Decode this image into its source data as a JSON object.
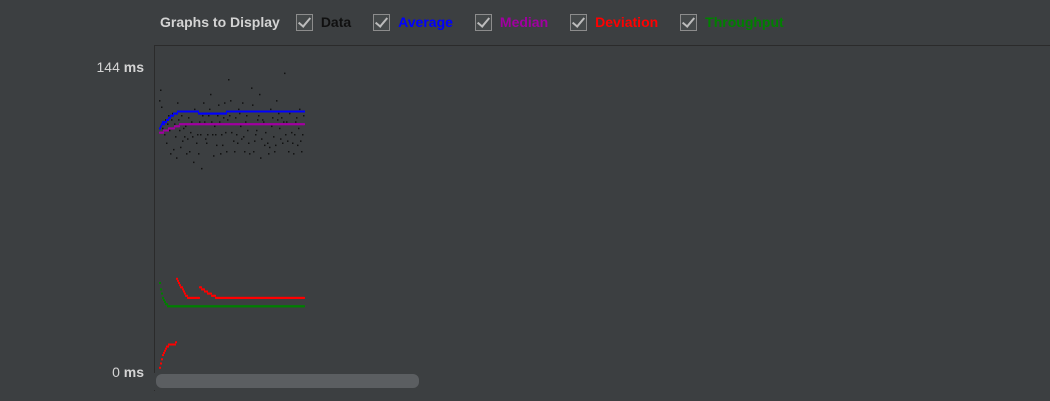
{
  "toolbar": {
    "title": "Graphs to Display",
    "options": [
      {
        "label": "Data",
        "color": "#101010",
        "checked": true
      },
      {
        "label": "Average",
        "color": "#0000ff",
        "checked": true
      },
      {
        "label": "Median",
        "color": "#a000a0",
        "checked": true
      },
      {
        "label": "Deviation",
        "color": "#ff0000",
        "checked": true
      },
      {
        "label": "Throughput",
        "color": "#008000",
        "checked": true
      }
    ]
  },
  "axis": {
    "top_value": "144",
    "bottom_value": "0",
    "unit": "ms"
  },
  "chart_data": {
    "type": "scatter",
    "ylim": [
      0,
      144
    ],
    "yunit": "ms",
    "n_samples": 145,
    "series": [
      {
        "name": "Data",
        "color": "#111111",
        "kind": "points",
        "values": [
          128,
          133,
          125,
          115,
          118,
          112,
          119,
          108,
          117,
          121,
          114,
          103,
          119,
          122,
          105,
          117,
          111,
          101,
          127,
          119,
          114,
          106,
          121,
          109,
          115,
          111,
          116,
          103,
          110,
          120,
          104,
          113,
          118,
          111,
          99,
          124,
          117,
          108,
          112,
          103,
          118,
          112,
          96,
          121,
          127,
          118,
          110,
          108,
          112,
          121,
          124,
          131,
          118,
          112,
          102,
          116,
          112,
          107,
          121,
          126,
          118,
          103,
          112,
          107,
          120,
          127,
          113,
          104,
          119,
          138,
          121,
          128,
          113,
          117,
          109,
          104,
          120,
          112,
          108,
          124,
          122,
          116,
          110,
          127,
          111,
          104,
          118,
          121,
          114,
          108,
          103,
          123,
          134,
          126,
          104,
          109,
          112,
          114,
          119,
          121,
          131,
          101,
          110,
          119,
          118,
          107,
          113,
          117,
          108,
          103,
          106,
          124,
          116,
          120,
          111,
          104,
          107,
          128,
          119,
          122,
          115,
          110,
          120,
          108,
          118,
          141,
          112,
          118,
          109,
          104,
          122,
          117,
          113,
          108,
          103,
          112,
          118,
          120,
          107,
          115,
          124,
          109,
          104,
          112,
          121
        ]
      },
      {
        "name": "Average",
        "color": "#0000ff",
        "kind": "points",
        "values": [
          115,
          116,
          117,
          118,
          117,
          118,
          118,
          119,
          119,
          120,
          120,
          121,
          121,
          121,
          122,
          122,
          122,
          122,
          123,
          123,
          123,
          123,
          123,
          123,
          123,
          123,
          123,
          123,
          123,
          123,
          123,
          123,
          123,
          123,
          123,
          123,
          123,
          123,
          123,
          122,
          122,
          122,
          122,
          122,
          122,
          122,
          122,
          122,
          122,
          122,
          122,
          122,
          122,
          122,
          122,
          122,
          122,
          122,
          122,
          122,
          122,
          122,
          122,
          122,
          122,
          122,
          122,
          123,
          123,
          123,
          123,
          123,
          123,
          123,
          123,
          123,
          123,
          123,
          123,
          123,
          123,
          123,
          123,
          123,
          123,
          123,
          123,
          123,
          123,
          123,
          123,
          123,
          123,
          123,
          123,
          123,
          123,
          123,
          123,
          123,
          123,
          123,
          123,
          123,
          123,
          123,
          123,
          123,
          123,
          123,
          123,
          123,
          123,
          123,
          123,
          123,
          123,
          123,
          123,
          123,
          123,
          123,
          123,
          123,
          123,
          123,
          123,
          123,
          123,
          123,
          123,
          123,
          123,
          123,
          123,
          123,
          123,
          123,
          123,
          123,
          123,
          123,
          123,
          123,
          123
        ]
      },
      {
        "name": "Median",
        "color": "#a000a0",
        "kind": "points",
        "values": [
          113,
          113,
          113,
          113,
          114,
          114,
          114,
          114,
          114,
          115,
          115,
          115,
          115,
          115,
          115,
          116,
          116,
          116,
          116,
          116,
          117,
          117,
          117,
          117,
          117,
          117,
          117,
          117,
          117,
          117,
          117,
          117,
          117,
          117,
          117,
          117,
          117,
          117,
          117,
          117,
          117,
          117,
          117,
          117,
          117,
          117,
          117,
          117,
          117,
          117,
          117,
          117,
          117,
          117,
          117,
          117,
          117,
          117,
          117,
          117,
          117,
          117,
          117,
          117,
          117,
          117,
          117,
          117,
          117,
          117,
          117,
          117,
          117,
          117,
          117,
          117,
          117,
          117,
          117,
          117,
          117,
          117,
          117,
          117,
          117,
          117,
          117,
          117,
          117,
          117,
          117,
          117,
          117,
          117,
          117,
          117,
          117,
          117,
          117,
          117,
          117,
          117,
          117,
          117,
          117,
          117,
          117,
          117,
          117,
          117,
          117,
          117,
          117,
          117,
          117,
          117,
          117,
          117,
          117,
          117,
          117,
          117,
          117,
          117,
          117,
          117,
          117,
          117,
          117,
          117,
          117,
          117,
          117,
          117,
          117,
          117,
          117,
          117,
          117,
          117,
          117,
          117,
          117,
          117,
          117
        ]
      },
      {
        "name": "Deviation",
        "color": "#ff0000",
        "kind": "points",
        "values": [
          2,
          4,
          6,
          8,
          9,
          10,
          11,
          12,
          12,
          13,
          13,
          13,
          13,
          13,
          13,
          13,
          14,
          44,
          43,
          42,
          41,
          40,
          40,
          39,
          38,
          37,
          36,
          36,
          35,
          35,
          35,
          35,
          35,
          35,
          35,
          35,
          35,
          35,
          35,
          35,
          40,
          40,
          39,
          39,
          39,
          38,
          38,
          38,
          37,
          37,
          37,
          37,
          36,
          36,
          36,
          36,
          35,
          35,
          35,
          35,
          35,
          35,
          35,
          35,
          35,
          35,
          35,
          35,
          35,
          35,
          35,
          35,
          35,
          35,
          35,
          35,
          35,
          35,
          35,
          35,
          35,
          35,
          35,
          35,
          35,
          35,
          35,
          35,
          35,
          35,
          35,
          35,
          35,
          35,
          35,
          35,
          35,
          35,
          35,
          35,
          35,
          35,
          35,
          35,
          35,
          35,
          35,
          35,
          35,
          35,
          35,
          35,
          35,
          35,
          35,
          35,
          35,
          35,
          35,
          35,
          35,
          35,
          35,
          35,
          35,
          35,
          35,
          35,
          35,
          35,
          35,
          35,
          35,
          35,
          35,
          35,
          35,
          35,
          35,
          35,
          35,
          35,
          35,
          35,
          35
        ]
      },
      {
        "name": "Throughput",
        "color": "#008000",
        "kind": "points",
        "values": [
          42,
          39,
          37,
          35,
          34,
          33,
          32,
          32,
          31,
          31,
          31,
          31,
          31,
          31,
          31,
          31,
          31,
          31,
          31,
          31,
          31,
          31,
          31,
          31,
          31,
          31,
          31,
          31,
          31,
          31,
          31,
          31,
          31,
          31,
          31,
          31,
          31,
          31,
          31,
          31,
          31,
          31,
          31,
          31,
          31,
          31,
          31,
          31,
          31,
          31,
          31,
          31,
          31,
          31,
          31,
          31,
          31,
          31,
          31,
          31,
          31,
          31,
          31,
          31,
          31,
          31,
          31,
          31,
          31,
          31,
          31,
          31,
          31,
          31,
          31,
          31,
          31,
          31,
          31,
          31,
          31,
          31,
          31,
          31,
          31,
          31,
          31,
          31,
          31,
          31,
          31,
          31,
          31,
          31,
          31,
          31,
          31,
          31,
          31,
          31,
          31,
          31,
          31,
          31,
          31,
          31,
          31,
          31,
          31,
          31,
          31,
          31,
          31,
          31,
          31,
          31,
          31,
          31,
          31,
          31,
          31,
          31,
          31,
          31,
          31,
          31,
          31,
          31,
          31,
          31,
          31,
          31,
          31,
          31,
          31,
          31,
          31,
          31,
          31,
          31,
          31,
          31,
          31,
          31,
          31
        ]
      }
    ]
  }
}
